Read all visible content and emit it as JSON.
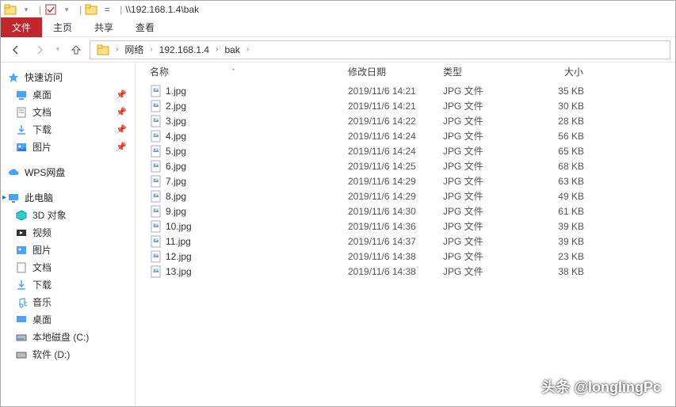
{
  "titlebar": {
    "path": "\\\\192.168.1.4\\bak",
    "sep": "|"
  },
  "ribbon": {
    "file": "文件",
    "home": "主页",
    "share": "共享",
    "view": "查看"
  },
  "breadcrumb": {
    "network": "网络",
    "host": "192.168.1.4",
    "folder": "bak"
  },
  "sidebar": {
    "quick_access": "快速访问",
    "desktop": "桌面",
    "documents": "文档",
    "downloads": "下载",
    "pictures": "图片",
    "wps": "WPS网盘",
    "this_pc": "此电脑",
    "objects3d": "3D 对象",
    "videos": "视频",
    "pictures2": "图片",
    "documents2": "文档",
    "downloads2": "下载",
    "music": "音乐",
    "desktop2": "桌面",
    "disk_c": "本地磁盘 (C:)",
    "disk_d": "软件 (D:)"
  },
  "columns": {
    "name": "名称",
    "date": "修改日期",
    "type": "类型",
    "size": "大小"
  },
  "files": [
    {
      "name": "1.jpg",
      "date": "2019/11/6 14:21",
      "type": "JPG 文件",
      "size": "35 KB"
    },
    {
      "name": "2.jpg",
      "date": "2019/11/6 14:21",
      "type": "JPG 文件",
      "size": "30 KB"
    },
    {
      "name": "3.jpg",
      "date": "2019/11/6 14:22",
      "type": "JPG 文件",
      "size": "28 KB"
    },
    {
      "name": "4.jpg",
      "date": "2019/11/6 14:24",
      "type": "JPG 文件",
      "size": "56 KB"
    },
    {
      "name": "5.jpg",
      "date": "2019/11/6 14:24",
      "type": "JPG 文件",
      "size": "65 KB"
    },
    {
      "name": "6.jpg",
      "date": "2019/11/6 14:25",
      "type": "JPG 文件",
      "size": "68 KB"
    },
    {
      "name": "7.jpg",
      "date": "2019/11/6 14:29",
      "type": "JPG 文件",
      "size": "63 KB"
    },
    {
      "name": "8.jpg",
      "date": "2019/11/6 14:29",
      "type": "JPG 文件",
      "size": "49 KB"
    },
    {
      "name": "9.jpg",
      "date": "2019/11/6 14:30",
      "type": "JPG 文件",
      "size": "61 KB"
    },
    {
      "name": "10.jpg",
      "date": "2019/11/6 14:36",
      "type": "JPG 文件",
      "size": "39 KB"
    },
    {
      "name": "11.jpg",
      "date": "2019/11/6 14:37",
      "type": "JPG 文件",
      "size": "39 KB"
    },
    {
      "name": "12.jpg",
      "date": "2019/11/6 14:38",
      "type": "JPG 文件",
      "size": "23 KB"
    },
    {
      "name": "13.jpg",
      "date": "2019/11/6 14:38",
      "type": "JPG 文件",
      "size": "38 KB"
    }
  ],
  "watermark": "头条 @longlingPc"
}
